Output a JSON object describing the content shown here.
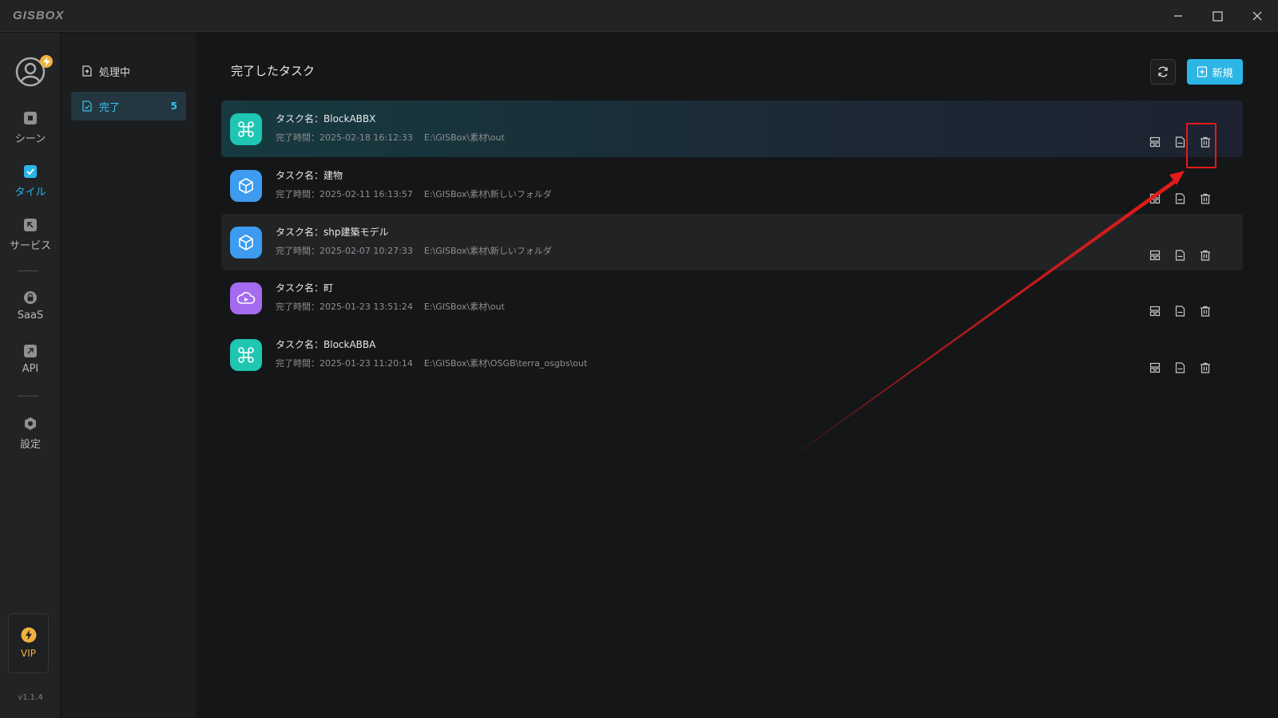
{
  "app": {
    "logo": "GISBOX",
    "version": "v1.1.4"
  },
  "rail": {
    "items": [
      {
        "label": "シーン"
      },
      {
        "label": "タイル"
      },
      {
        "label": "サービス"
      },
      {
        "label": "SaaS"
      },
      {
        "label": "API"
      },
      {
        "label": "設定"
      }
    ],
    "vip_label": "VIP"
  },
  "subnav": {
    "processing_label": "処理中",
    "done_label": "完了",
    "done_count": "5"
  },
  "main": {
    "title": "完了したタスク",
    "new_label": "新規"
  },
  "tasks": [
    {
      "name": "タスク名：BlockABBX",
      "time": "完了時間：2025-02-18 16:12:33",
      "path": "E:\\GISBox\\素材\\out",
      "icon": "drone-icon",
      "color": "#1fc6b2"
    },
    {
      "name": "タスク名：建物",
      "time": "完了時間：2025-02-11 16:13:57",
      "path": "E:\\GISBox\\素材\\新しいフォルダ",
      "icon": "cube-icon",
      "color": "#3d9bf0"
    },
    {
      "name": "タスク名：shp建築モデル",
      "time": "完了時間：2025-02-07 10:27:33",
      "path": "E:\\GISBox\\素材\\新しいフォルダ",
      "icon": "cube-icon",
      "color": "#3d9bf0"
    },
    {
      "name": "タスク名：町",
      "time": "完了時間：2025-01-23 13:51:24",
      "path": "E:\\GISBox\\素材\\out",
      "icon": "cloud-play-icon",
      "color": "#a46bf0"
    },
    {
      "name": "タスク名：BlockABBA",
      "time": "完了時間：2025-01-23 11:20:14",
      "path": "E:\\GISBox\\素材\\OSGB\\terra_osgbs\\out",
      "icon": "drone-icon",
      "color": "#1fc6b2"
    }
  ],
  "colors": {
    "accent": "#2cb6e6",
    "vip": "#f0b23c",
    "callout": "#e51b1b"
  }
}
